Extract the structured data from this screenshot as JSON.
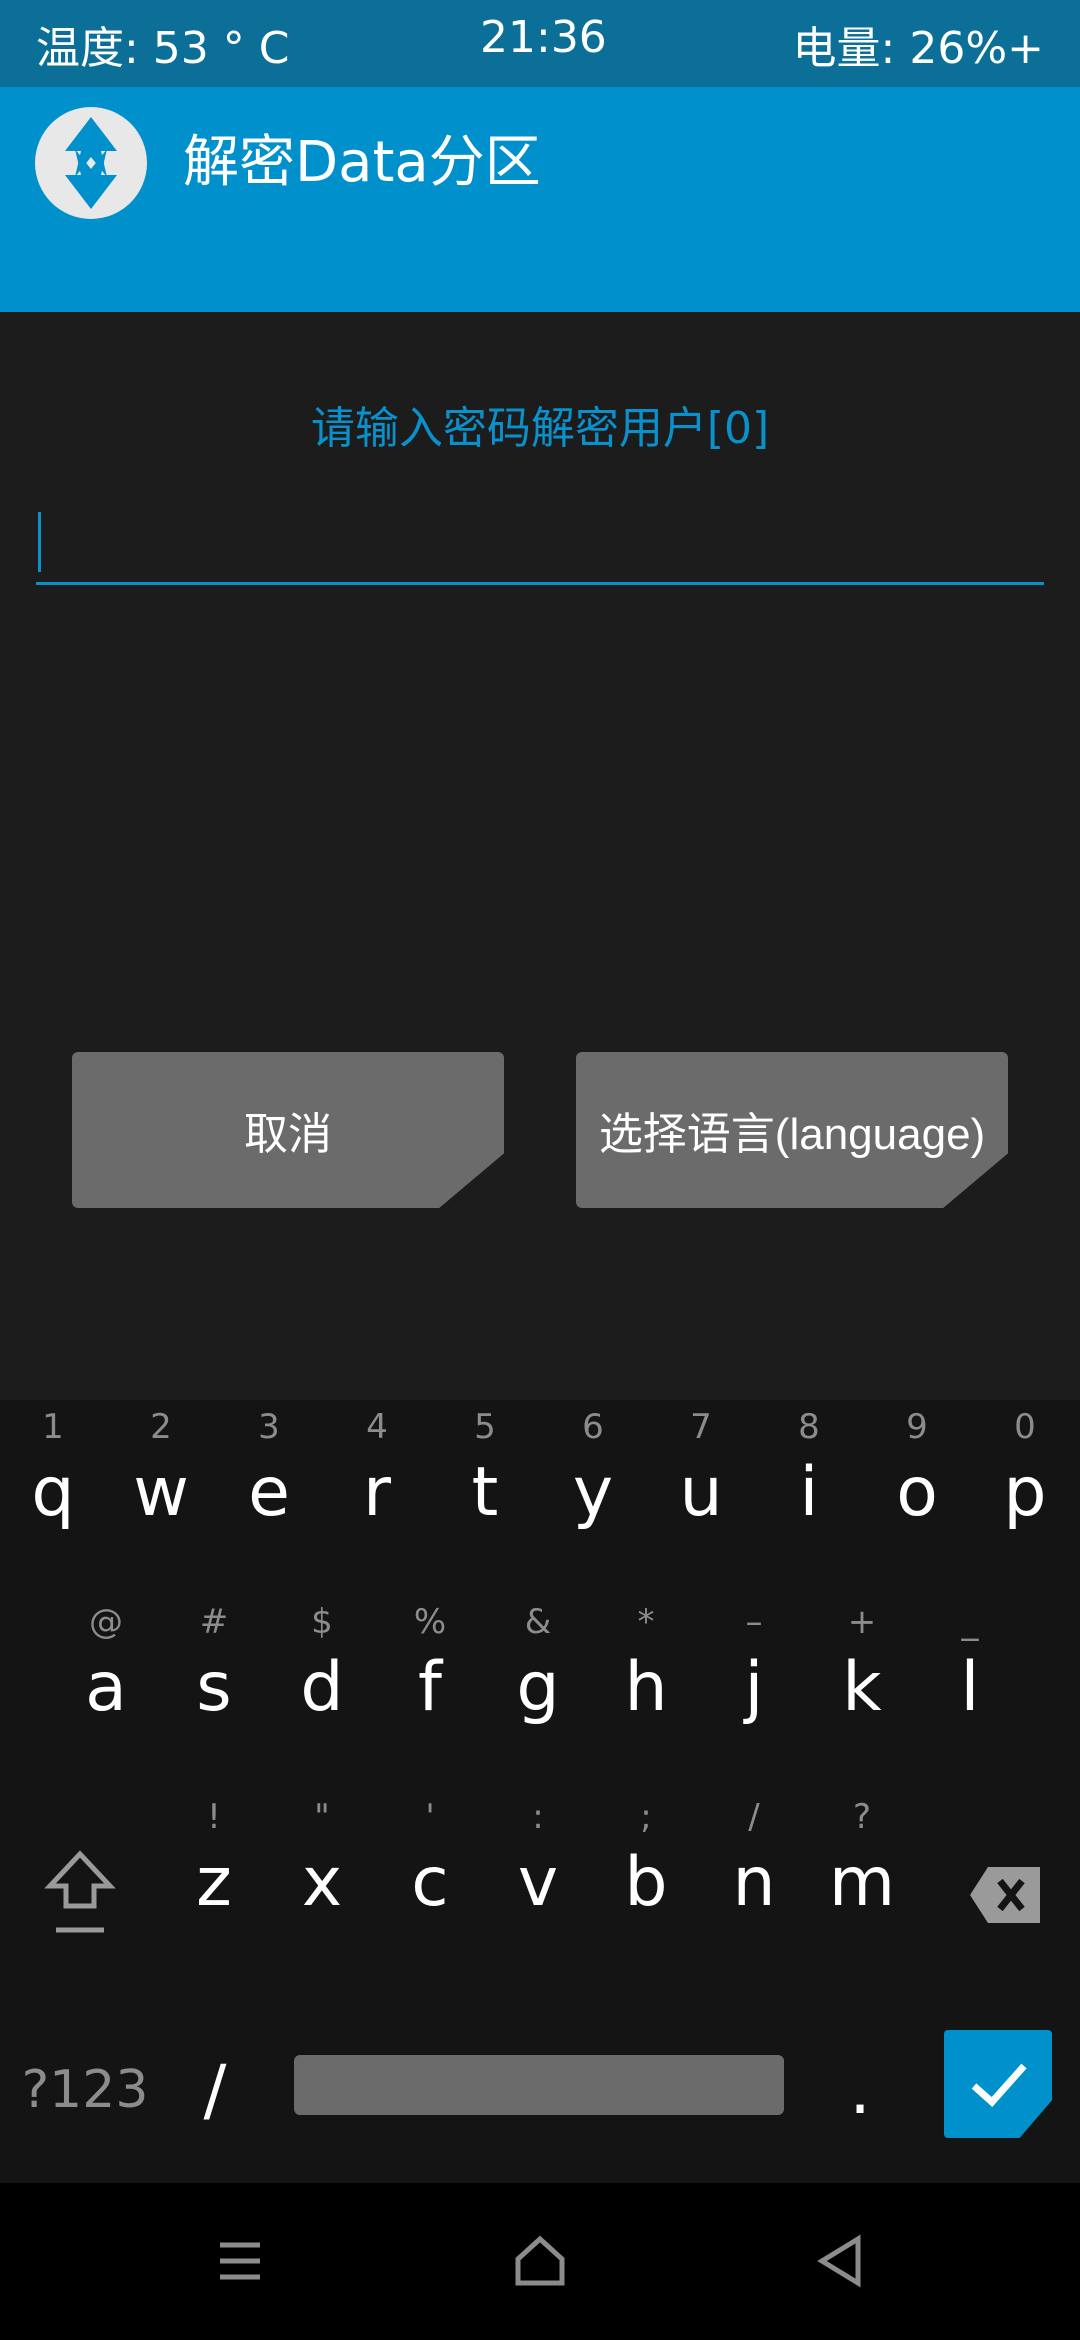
{
  "status_bar": {
    "temperature": "温度: 53 ° C",
    "time": "21:36",
    "battery": "电量: 26%+"
  },
  "header": {
    "title": "解密Data分区",
    "logo_icon": "twrp-logo-icon"
  },
  "content": {
    "prompt": "请输入密码解密用户[0]",
    "password_value": ""
  },
  "buttons": {
    "cancel": "取消",
    "language": "选择语言(language)"
  },
  "keyboard": {
    "row1": [
      {
        "key": "q",
        "hint": "1"
      },
      {
        "key": "w",
        "hint": "2"
      },
      {
        "key": "e",
        "hint": "3"
      },
      {
        "key": "r",
        "hint": "4"
      },
      {
        "key": "t",
        "hint": "5"
      },
      {
        "key": "y",
        "hint": "6"
      },
      {
        "key": "u",
        "hint": "7"
      },
      {
        "key": "i",
        "hint": "8"
      },
      {
        "key": "o",
        "hint": "9"
      },
      {
        "key": "p",
        "hint": "0"
      }
    ],
    "row2": [
      {
        "key": "a",
        "hint": "@"
      },
      {
        "key": "s",
        "hint": "#"
      },
      {
        "key": "d",
        "hint": "$"
      },
      {
        "key": "f",
        "hint": "%"
      },
      {
        "key": "g",
        "hint": "&"
      },
      {
        "key": "h",
        "hint": "*"
      },
      {
        "key": "j",
        "hint": "–"
      },
      {
        "key": "k",
        "hint": "+"
      },
      {
        "key": "l",
        "hint": "_"
      }
    ],
    "row3": [
      {
        "key": "z",
        "hint": "!"
      },
      {
        "key": "x",
        "hint": "\""
      },
      {
        "key": "c",
        "hint": "'"
      },
      {
        "key": "v",
        "hint": ":"
      },
      {
        "key": "b",
        "hint": ";"
      },
      {
        "key": "n",
        "hint": "/"
      },
      {
        "key": "m",
        "hint": "?"
      }
    ],
    "symbols_label": "?123",
    "slash": "/",
    "period": "."
  },
  "colors": {
    "accent": "#0090cb",
    "status_bar": "#0b6f98",
    "button": "#6b6b6b",
    "background": "#1c1c1c"
  }
}
